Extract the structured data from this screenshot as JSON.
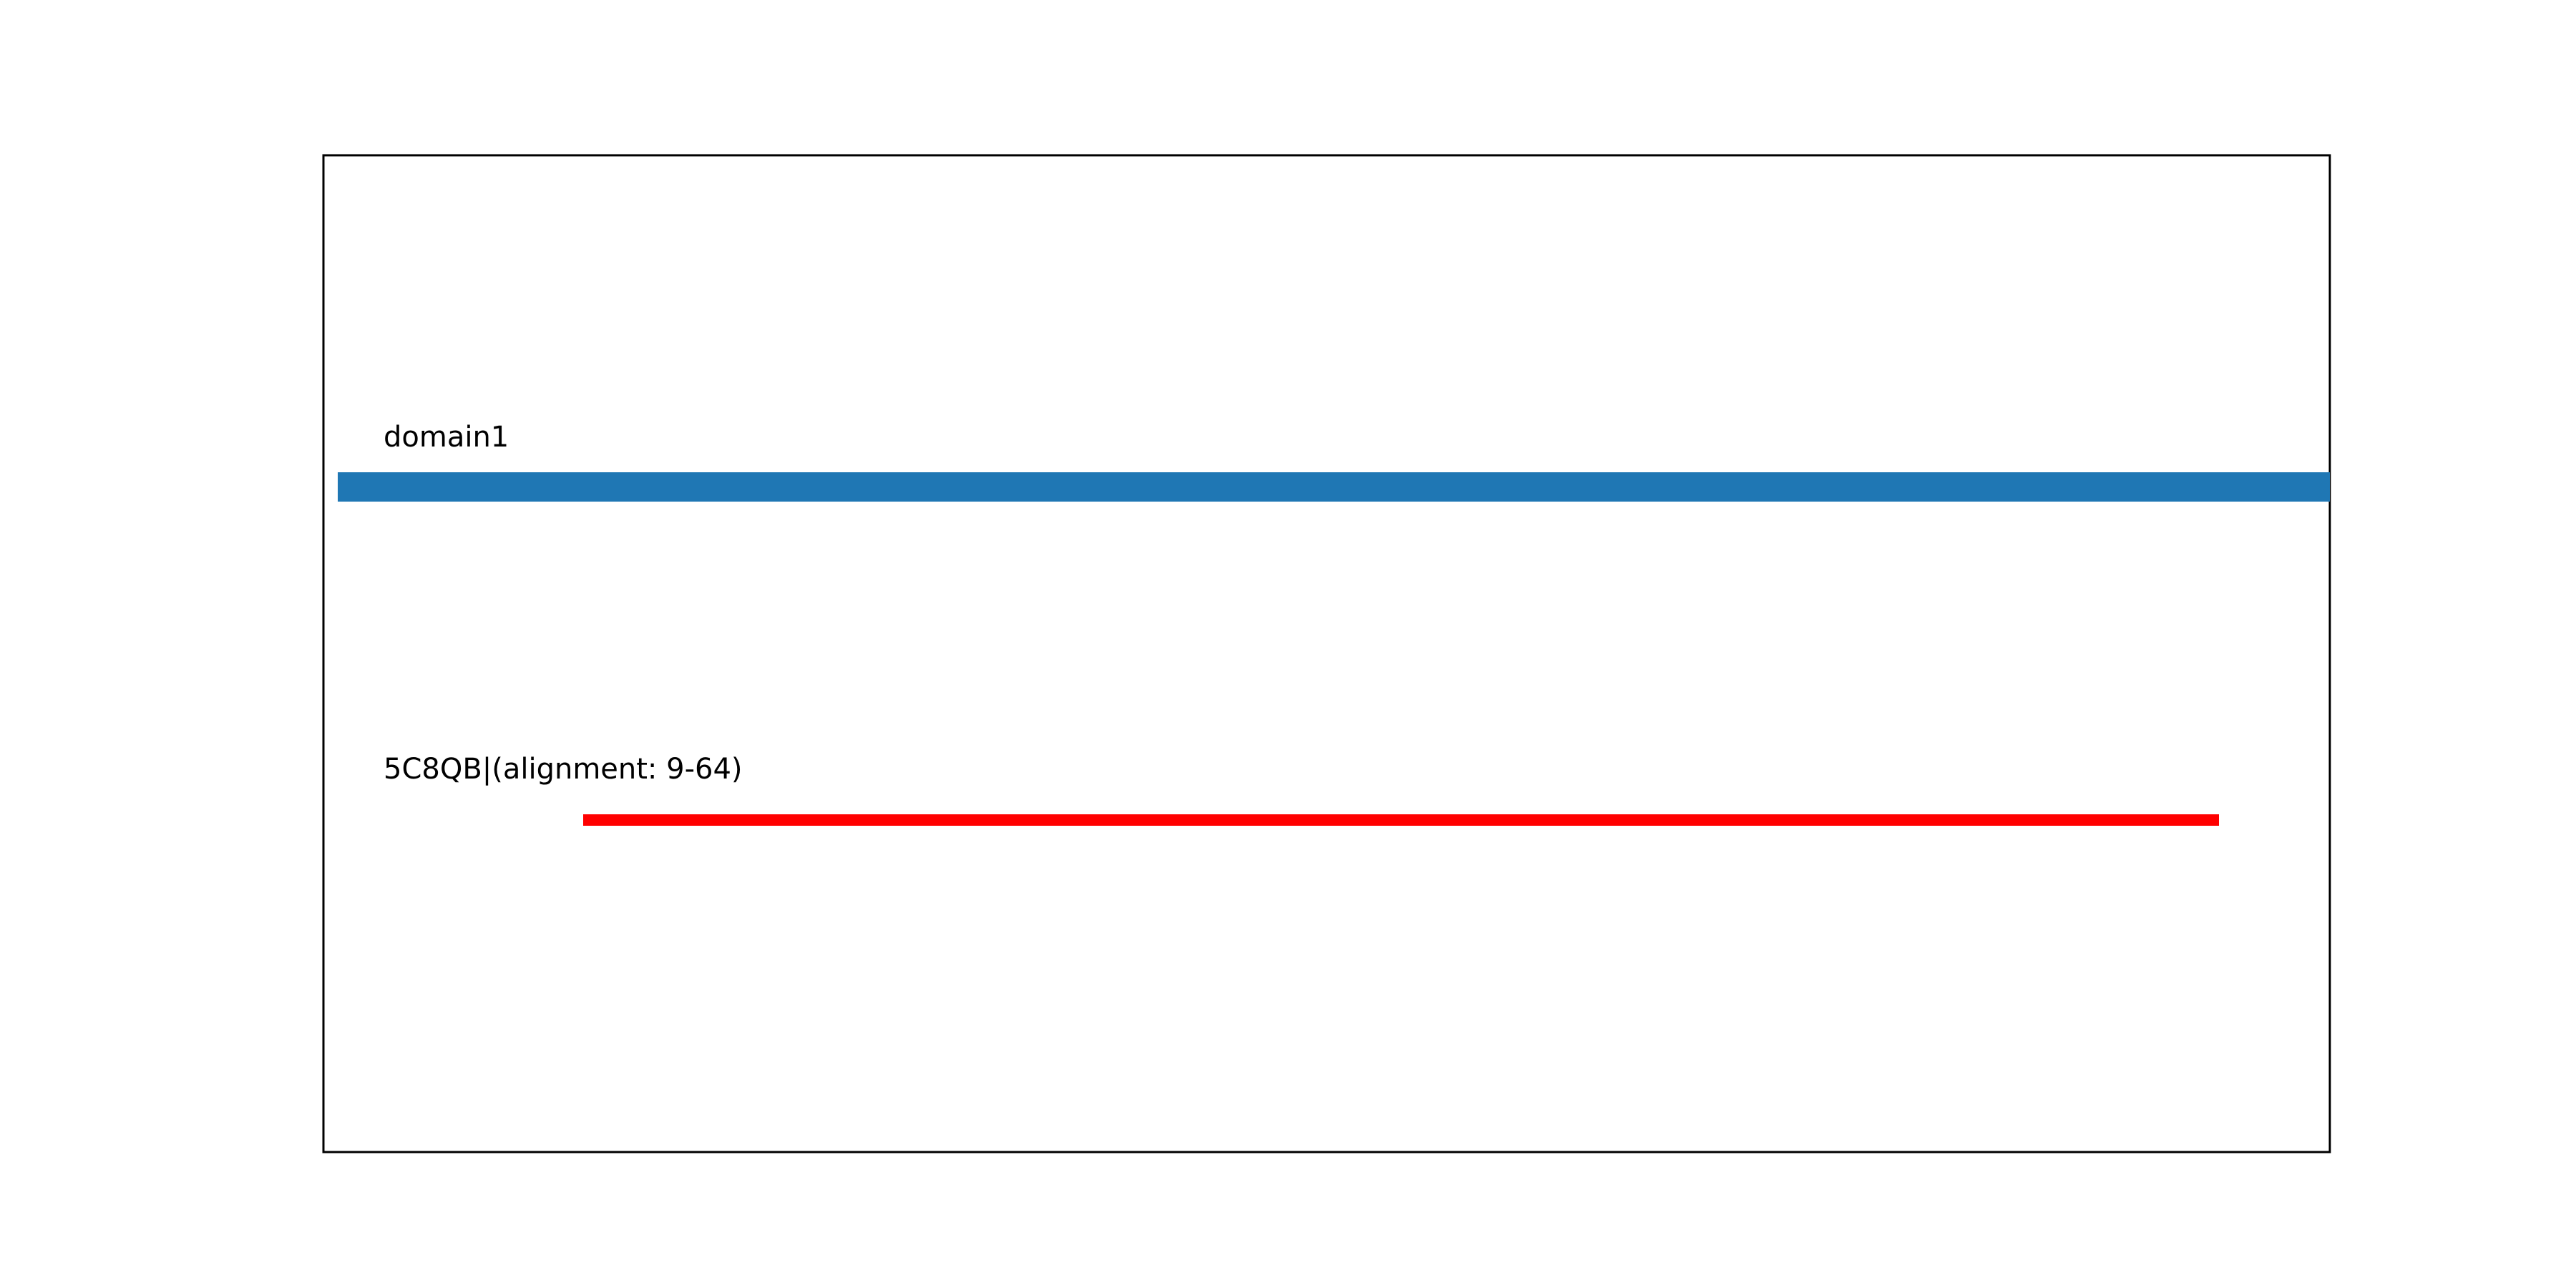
{
  "diagram": {
    "tracks": [
      {
        "label": "domain1",
        "color": "#1f77b4"
      },
      {
        "label": "5C8QB|(alignment: 9-64)",
        "color": "#ff0000"
      }
    ]
  }
}
